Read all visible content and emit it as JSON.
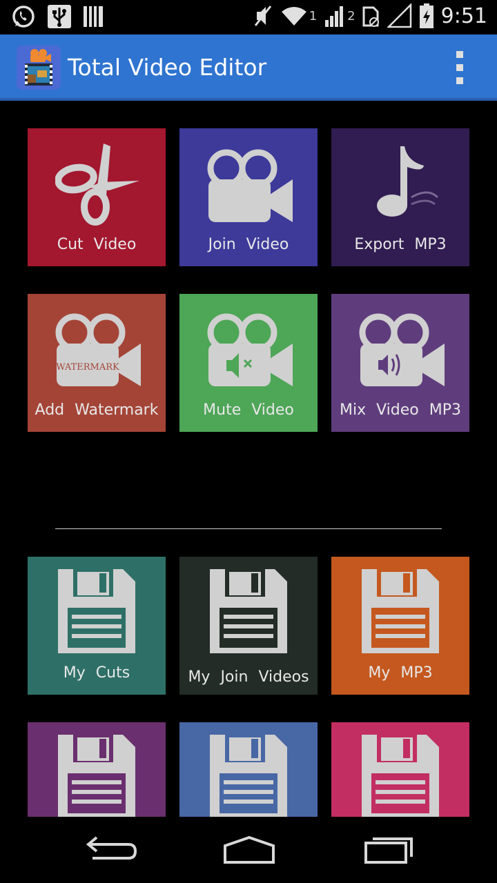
{
  "status_bar": {
    "time": "9:51",
    "sim1": "1",
    "sim2": "2",
    "icons": [
      "whatsapp-icon",
      "usb-icon",
      "barcode-icon",
      "mute-icon",
      "wifi-icon",
      "signal-icon",
      "sim-icon",
      "battery-icon"
    ]
  },
  "app_bar": {
    "title": "Total Video Editor",
    "icons": [
      "app-logo-icon",
      "overflow-menu-icon"
    ]
  },
  "tiles_top": [
    {
      "label": "Cut  Video",
      "color": "#a3172f",
      "icon": "scissors-icon"
    },
    {
      "label": "Join  Video",
      "color": "#3d3a9a",
      "icon": "video-camera-icon"
    },
    {
      "label": "Export  MP3",
      "color": "#311d52",
      "icon": "music-note-icon"
    },
    {
      "label": "Add  Watermark",
      "color": "#a44437",
      "icon": "watermark-camera-icon",
      "icon_text": "WATERMARK"
    },
    {
      "label": "Mute  Video",
      "color": "#4ea657",
      "icon": "mute-camera-icon"
    },
    {
      "label": "Mix  Video  MP3",
      "color": "#5f3d7d",
      "icon": "audio-camera-icon"
    }
  ],
  "tiles_bottom": [
    {
      "label": "My  Cuts",
      "color": "#2e7067"
    },
    {
      "label": "My  Join  Videos",
      "color": "#232c27"
    },
    {
      "label": "My  MP3",
      "color": "#c4581f"
    },
    {
      "label": "",
      "color": "#6a2f6f"
    },
    {
      "label": "",
      "color": "#4867a5"
    },
    {
      "label": "",
      "color": "#c22e61"
    }
  ],
  "nav_bar": {
    "icons": [
      "back-icon",
      "home-icon",
      "recent-apps-icon"
    ]
  }
}
